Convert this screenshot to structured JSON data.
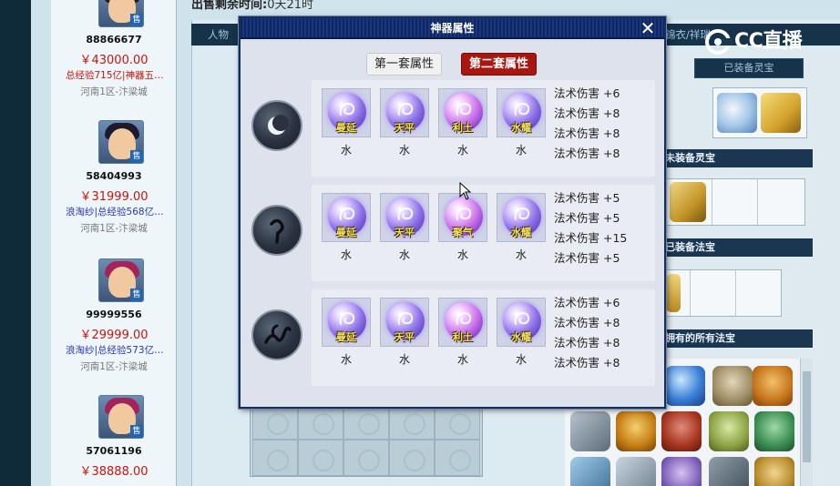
{
  "page": {
    "top_title_label": "出售剩余时间:",
    "top_title_value": "0天21时",
    "tabs_partial": [
      "人物",
      "锦衣/祥瑞"
    ],
    "right_tab": "已装备灵宝"
  },
  "logo": {
    "text": "CC直播"
  },
  "listings": [
    {
      "id": "88866677",
      "price": "￥43000.00",
      "desc": "总经验715亿|神器五…",
      "server": "河南1区-汴梁城",
      "desc_color": "#c8150e",
      "hair": "#2b1a10"
    },
    {
      "id": "58404993",
      "price": "￥31999.00",
      "desc": "浪淘纱|总经验568亿…",
      "server": "河南1区-汴梁城",
      "desc_color": "#2a35b8",
      "hair": "#1d1a2e"
    },
    {
      "id": "99999556",
      "price": "￥29999.00",
      "desc": "浪淘纱|总经验573亿…",
      "server": "河南1区-汴梁城",
      "desc_color": "#2a35b8",
      "hair": "#a3245a"
    },
    {
      "id": "57061196",
      "price": "￥38888.00",
      "desc": "",
      "server": "",
      "desc_color": "#2a35b8",
      "hair": "#a3245a"
    }
  ],
  "right_panel": {
    "sections": [
      "已装备灵宝",
      "未装备灵宝",
      "已装备法宝",
      "拥有的所有法宝"
    ]
  },
  "dialog": {
    "title": "神器属性",
    "close_label": "✕",
    "set_buttons": [
      {
        "label": "第一套属性",
        "active": false
      },
      {
        "label": "第二套属性",
        "active": true
      }
    ],
    "rows": [
      {
        "emblem": "crescent-moon",
        "gems": [
          {
            "name": "曼延",
            "element": "水",
            "tint": "blue"
          },
          {
            "name": "天平",
            "element": "水",
            "tint": "blue"
          },
          {
            "name": "利土",
            "element": "水",
            "tint": "pink"
          },
          {
            "name": "水耀",
            "element": "水",
            "tint": "blue"
          }
        ],
        "stats": [
          "法术伤害 +6",
          "法术伤害 +8",
          "法术伤害 +8",
          "法术伤害 +8"
        ]
      },
      {
        "emblem": "hook",
        "gems": [
          {
            "name": "曼延",
            "element": "水",
            "tint": "blue"
          },
          {
            "name": "天平",
            "element": "水",
            "tint": "blue"
          },
          {
            "name": "聚气",
            "element": "水",
            "tint": "pink"
          },
          {
            "name": "水耀",
            "element": "水",
            "tint": "blue"
          }
        ],
        "stats": [
          "法术伤害 +5",
          "法术伤害 +5",
          "法术伤害 +15",
          "法术伤害 +5"
        ]
      },
      {
        "emblem": "vine",
        "gems": [
          {
            "name": "曼延",
            "element": "水",
            "tint": "blue"
          },
          {
            "name": "天平",
            "element": "水",
            "tint": "blue"
          },
          {
            "name": "利土",
            "element": "水",
            "tint": "pink"
          },
          {
            "name": "水耀",
            "element": "水",
            "tint": "blue"
          }
        ],
        "stats": [
          "法术伤害 +6",
          "法术伤害 +8",
          "法术伤害 +8",
          "法术伤害 +8"
        ]
      }
    ]
  }
}
